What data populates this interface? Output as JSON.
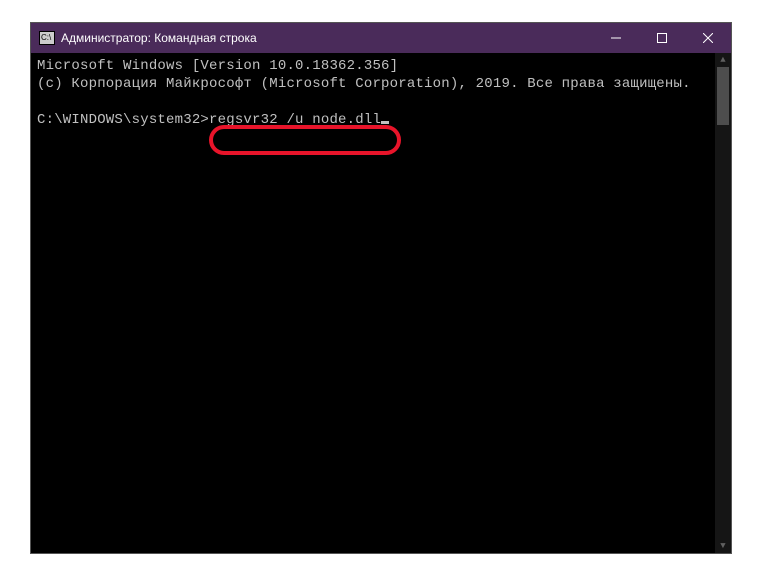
{
  "titlebar": {
    "title": "Администратор: Командная строка"
  },
  "console": {
    "line1": "Microsoft Windows [Version 10.0.18362.356]",
    "line2": "(c) Корпорация Майкрософт (Microsoft Corporation), 2019. Все права защищены.",
    "prompt": "C:\\WINDOWS\\system32>",
    "command": "regsvr32 /u node.dll"
  },
  "icons": {
    "app": "C:\\"
  }
}
